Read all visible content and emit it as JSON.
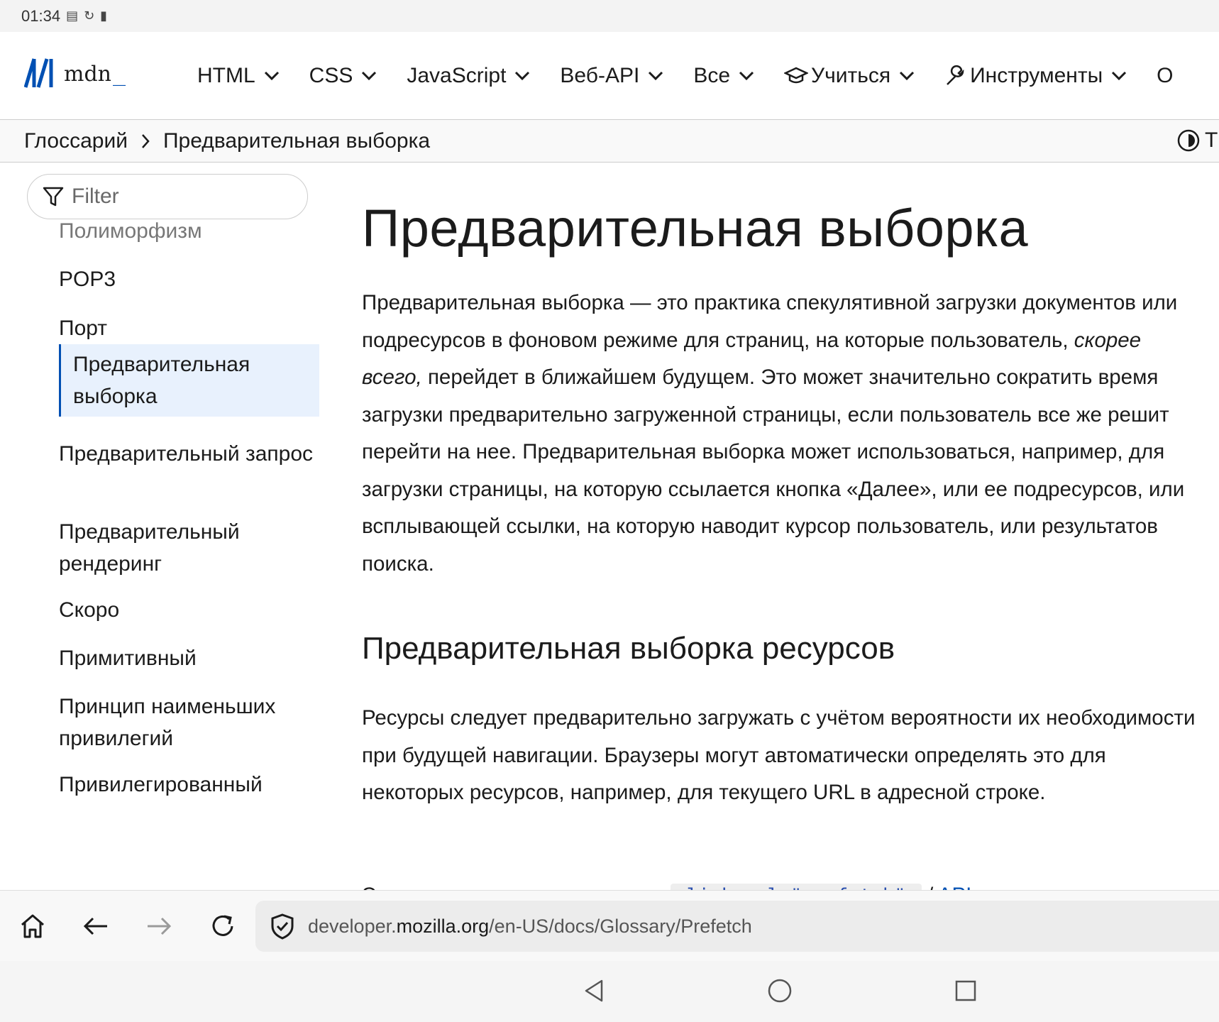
{
  "status_bar": {
    "time": "01:34",
    "icons": [
      "vpn-icon",
      "sync-icon",
      "battery-icon"
    ]
  },
  "header": {
    "logo_text": "mdn",
    "logo_underscore": "_",
    "nav": [
      {
        "label": "HTML",
        "icon": ""
      },
      {
        "label": "CSS",
        "icon": ""
      },
      {
        "label": "JavaScript",
        "icon": ""
      },
      {
        "label": "Веб-API",
        "icon": ""
      },
      {
        "label": "Все",
        "icon": ""
      },
      {
        "label": "Учиться",
        "icon": "graduation-cap-icon"
      },
      {
        "label": "Инструменты",
        "icon": "wrench-icon"
      },
      {
        "label": "О",
        "icon": ""
      }
    ]
  },
  "breadcrumb": {
    "items": [
      "Глоссарий",
      "Предварительная выборка"
    ],
    "theme_label": "Т"
  },
  "sidebar": {
    "filter_placeholder": "Filter",
    "items": [
      {
        "label": "Полиморфизм",
        "state": "faded"
      },
      {
        "label": "POP3",
        "state": "normal"
      },
      {
        "label": "Порт",
        "state": "normal"
      },
      {
        "label": "Предварительная выборка",
        "state": "active"
      },
      {
        "label": "Предварительный запрос",
        "state": "normal"
      },
      {
        "label": "Предварительный рендеринг",
        "state": "normal"
      },
      {
        "label": "Скоро",
        "state": "normal"
      },
      {
        "label": "Примитивный",
        "state": "normal"
      },
      {
        "label": "Принцип наименьших привилегий",
        "state": "normal"
      },
      {
        "label": "Привилегированный",
        "state": "normal"
      }
    ]
  },
  "main": {
    "title": "Предварительная выборка",
    "p1_part1": "Предварительная выборка — это практика спекулятивной загрузки документов или подресурсов в фоновом режиме для страниц, на которые пользователь,",
    "p1_em": "скорее всего,",
    "p1_part2": "перейдет в ближайшем будущем. Это может значительно сократить время загрузки предварительно загруженной страницы, если пользователь все же решит перейти на нее. Предварительная выборка может использоваться, например, для загрузки страницы, на которую ссылается кнопка «Далее», или ее подресурсов, или всплывающей ссылки, на которую наводит курсор пользователь, или результатов поиска.",
    "h2": "Предварительная выборка ресурсов",
    "p2": "Ресурсы следует предварительно загружать с учётом вероятности их необходимости при будущей навигации. Браузеры могут автоматически определять это для некоторых ресурсов, например, для текущего URL в адресной строке.",
    "p3_start": "Это можно сделать с помощью",
    "p3_code": "<link rel=\"prefetch\">",
    "p3_sep": "/",
    "p3_link": "API правил"
  },
  "browser": {
    "url_prefix": "developer.",
    "url_domain": "mozilla.org",
    "url_path": "/en-US/docs/Glossary/Prefetch"
  }
}
